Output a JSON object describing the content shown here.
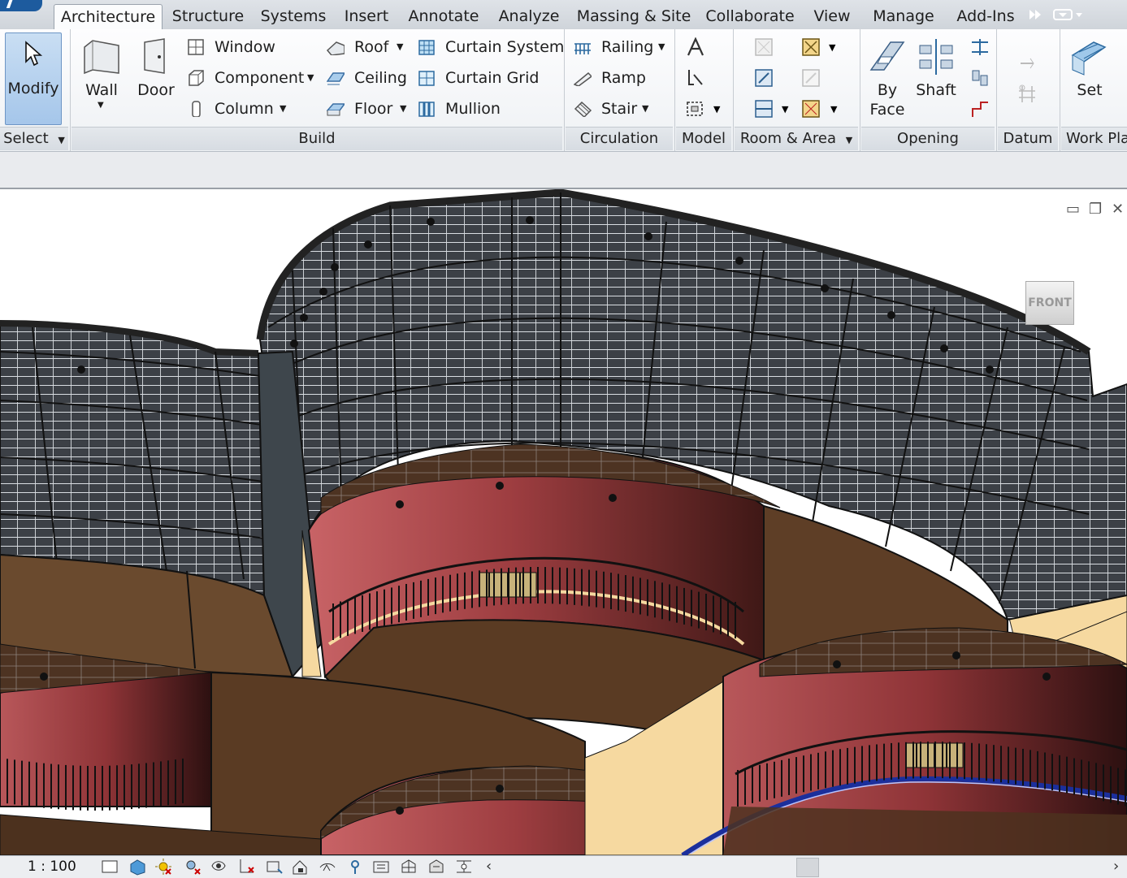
{
  "tabs": [
    "Architecture",
    "Structure",
    "Systems",
    "Insert",
    "Annotate",
    "Analyze",
    "Massing & Site",
    "Collaborate",
    "View",
    "Manage",
    "Add-Ins"
  ],
  "active_tab": "Architecture",
  "ribbon": {
    "select": {
      "modify": "Modify",
      "panel": "Select"
    },
    "build": {
      "panel": "Build",
      "wall": "Wall",
      "door": "Door",
      "window": "Window",
      "component": "Component",
      "column": "Column",
      "roof": "Roof",
      "ceiling": "Ceiling",
      "floor": "Floor",
      "curtain_system": "Curtain  System",
      "curtain_grid": "Curtain  Grid",
      "mullion": "Mullion"
    },
    "circulation": {
      "panel": "Circulation",
      "railing": "Railing",
      "ramp": "Ramp",
      "stair": "Stair"
    },
    "model": {
      "panel": "Model"
    },
    "room_area": {
      "panel": "Room & Area"
    },
    "opening": {
      "panel": "Opening",
      "by_face_1": "By",
      "by_face_2": "Face",
      "shaft": "Shaft"
    },
    "datum": {
      "panel": "Datum"
    },
    "work_plane": {
      "panel": "Work Pla",
      "set": "Set"
    }
  },
  "viewcube": {
    "face": "FRONT"
  },
  "status": {
    "scale": "1 : 100"
  },
  "colors": {
    "accent": "#1d5b9e",
    "glass": "#3a3d42",
    "wall_red": "#9a3a3c",
    "wall_brown": "#5a3b23",
    "slab": "#f6d9a0"
  }
}
